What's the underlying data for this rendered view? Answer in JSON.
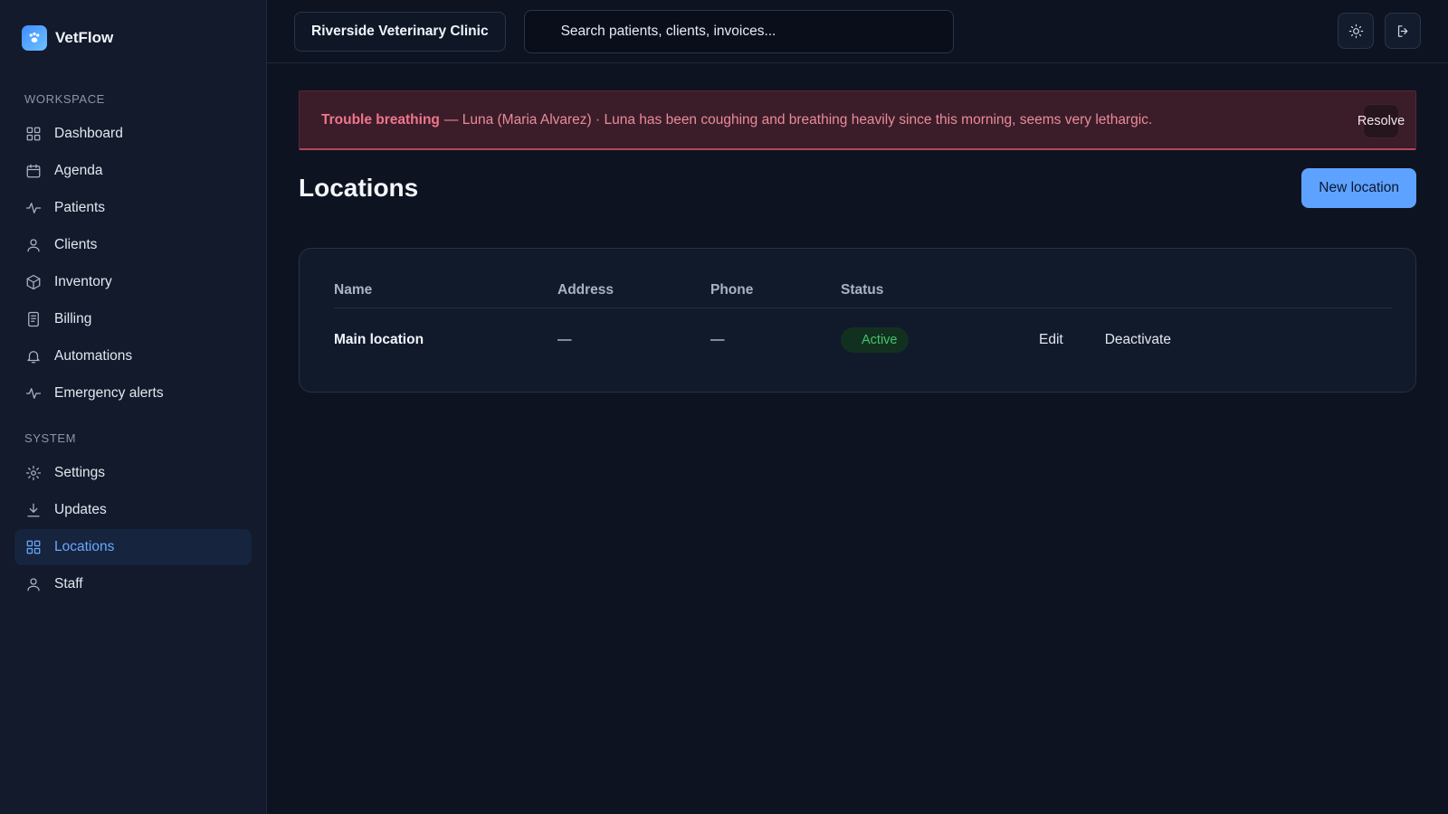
{
  "brand": {
    "name": "VetFlow"
  },
  "sidebar": {
    "workspace_label": "WORKSPACE",
    "workspace_items": [
      {
        "label": "Dashboard",
        "icon": "grid-icon"
      },
      {
        "label": "Agenda",
        "icon": "calendar-icon"
      },
      {
        "label": "Patients",
        "icon": "pulse-icon"
      },
      {
        "label": "Clients",
        "icon": "user-icon"
      },
      {
        "label": "Inventory",
        "icon": "box-icon"
      },
      {
        "label": "Billing",
        "icon": "receipt-icon"
      },
      {
        "label": "Automations",
        "icon": "bell-icon"
      },
      {
        "label": "Emergency alerts",
        "icon": "pulse-icon"
      }
    ],
    "system_label": "SYSTEM",
    "system_items": [
      {
        "label": "Settings",
        "icon": "gear-icon"
      },
      {
        "label": "Updates",
        "icon": "download-icon"
      },
      {
        "label": "Locations",
        "icon": "grid-icon",
        "active": true
      },
      {
        "label": "Staff",
        "icon": "user-icon"
      }
    ]
  },
  "topbar": {
    "clinic_name": "Riverside Veterinary Clinic",
    "search_placeholder": "Search patients, clients, invoices...",
    "theme_icon": "sun-icon",
    "logout_icon": "logout-icon"
  },
  "alert": {
    "title": "Trouble breathing",
    "text": "— Luna (Maria Alvarez) · Luna has been coughing and breathing heavily since this morning, seems very lethargic.",
    "resolve_label": "Resolve"
  },
  "page": {
    "title": "Locations",
    "new_button": "New location"
  },
  "table": {
    "headers": {
      "name": "Name",
      "address": "Address",
      "phone": "Phone",
      "status": "Status"
    },
    "rows": [
      {
        "name": "Main location",
        "address": "—",
        "phone": "—",
        "status": "Active",
        "edit": "Edit",
        "deactivate": "Deactivate"
      }
    ]
  },
  "colors": {
    "accent": "#5ea2ff",
    "active_badge": "#46c36b",
    "alert": "#f0768e"
  }
}
